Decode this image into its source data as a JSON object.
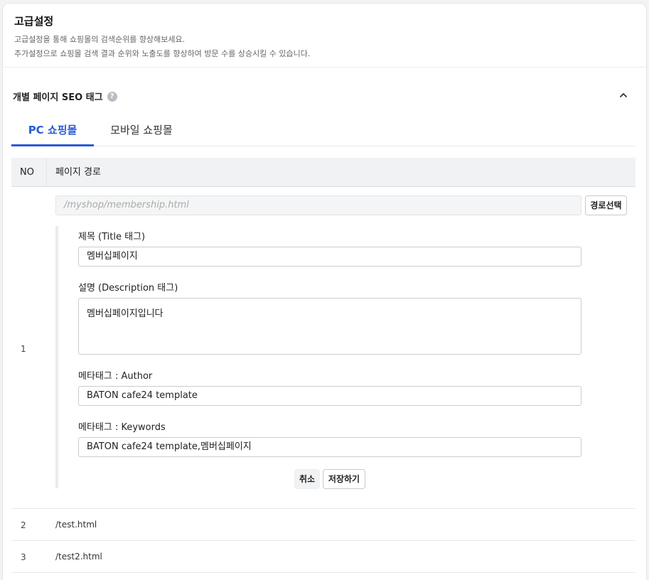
{
  "header": {
    "title": "고급설정",
    "desc_line1": "고급설정을 통해 쇼핑몰의 검색순위를 향상해보세요.",
    "desc_line2": "추가설정으로 쇼핑몰 검색 결과 순위와 노출도를 향상하여 방문 수를 상승시킬 수 있습니다."
  },
  "section": {
    "title": "개별 페이지 SEO 태그",
    "help_icon": "question-circle-icon",
    "collapse_icon": "chevron-up-icon"
  },
  "tabs": [
    {
      "label": "PC 쇼핑몰",
      "active": true
    },
    {
      "label": "모바일 쇼핑몰",
      "active": false
    }
  ],
  "table": {
    "columns": [
      "NO",
      "페이지 경로"
    ],
    "rows": [
      {
        "no": "1",
        "path_placeholder": "/myshop/membership.html",
        "path_select_label": "경로선택",
        "fields": {
          "title_label": "제목 (Title 태그)",
          "title_value": "멤버십페이지",
          "description_label": "설명 (Description 태그)",
          "description_value": "멤버십페이지입니다",
          "author_label": "메타태그 : Author",
          "author_value": "BATON cafe24 template",
          "keywords_label": "메타태그 : Keywords",
          "keywords_value": "BATON cafe24 template,멤버십페이지"
        },
        "cancel_label": "취소",
        "save_label": "저장하기"
      },
      {
        "no": "2",
        "path": "/test.html"
      },
      {
        "no": "3",
        "path": "/test2.html"
      }
    ]
  },
  "colors": {
    "accent": "#2a5bd7",
    "header_bg": "#f1f2f4",
    "border": "#e6e8eb"
  }
}
